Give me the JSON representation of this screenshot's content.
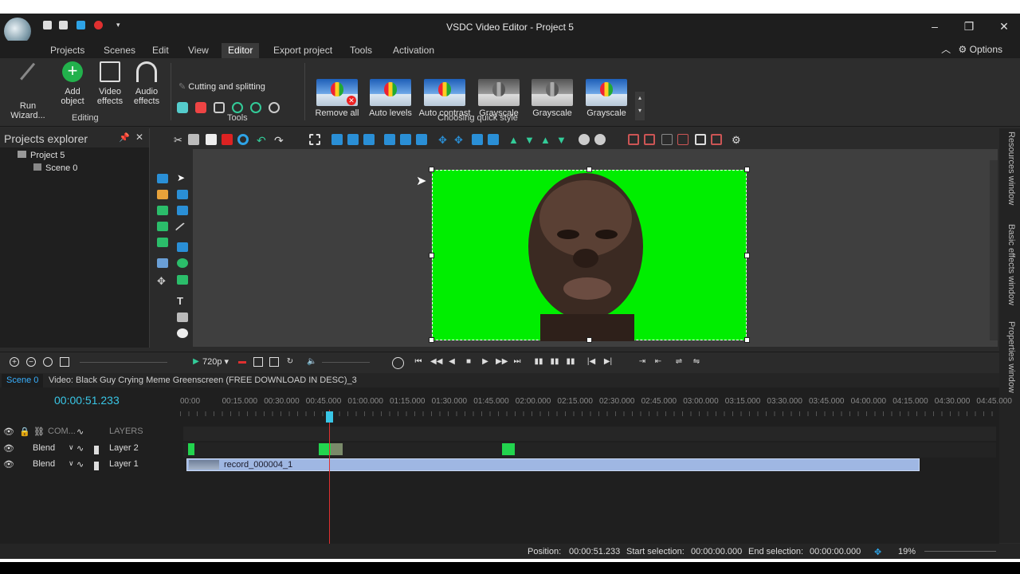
{
  "window": {
    "title": "VSDC Video Editor - Project 5"
  },
  "menu": {
    "items": [
      "Projects",
      "Scenes",
      "Edit",
      "View",
      "Editor",
      "Export project",
      "Tools",
      "Activation"
    ],
    "active": "Editor",
    "options_label": "Options"
  },
  "ribbon": {
    "run_wizard": "Run Wizard...",
    "add_object": "Add object",
    "video_effects": "Video effects",
    "audio_effects": "Audio effects",
    "editing_group": "Editing",
    "cutting_splitting": "Cutting and splitting",
    "tools_group": "Tools",
    "quick_styles": [
      "Remove all",
      "Auto levels",
      "Auto contrast",
      "Grayscale",
      "Grayscale",
      "Grayscale"
    ],
    "quick_style_group": "Choosing quick style"
  },
  "explorer": {
    "title": "Projects explorer",
    "project": "Project 5",
    "scene": "Scene 0"
  },
  "side_tabs": [
    "Resources window",
    "Basic effects window",
    "Properties window"
  ],
  "timeline_toolbar": {
    "resolution": "720p"
  },
  "tabs": {
    "scene": "Scene 0",
    "video": "Video: Black Guy Crying Meme Greenscreen (FREE DOWNLOAD IN DESC)_3"
  },
  "timeline": {
    "timecode": "00:00:51.233",
    "ruler": [
      "00:00",
      "00:15.000",
      "00:30.000",
      "00:45.000",
      "01:00.000",
      "01:15.000",
      "01:30.000",
      "01:45.000",
      "02:00.000",
      "02:15.000",
      "02:30.000",
      "02:45.000",
      "03:00.000",
      "03:15.000",
      "03:30.000",
      "03:45.000",
      "04:00.000",
      "04:15.000",
      "04:30.000",
      "04:45.000"
    ],
    "header_com": "COM...",
    "header_layers": "LAYERS",
    "tracks": [
      {
        "blend": "Blend",
        "name": "Layer 2"
      },
      {
        "blend": "Blend",
        "name": "Layer 1",
        "clip": "record_000004_1"
      }
    ]
  },
  "status": {
    "position_label": "Position:",
    "position_value": "00:00:51.233",
    "start_label": "Start selection:",
    "start_value": "00:00:00.000",
    "end_label": "End selection:",
    "end_value": "00:00:00.000",
    "zoom": "19%"
  }
}
